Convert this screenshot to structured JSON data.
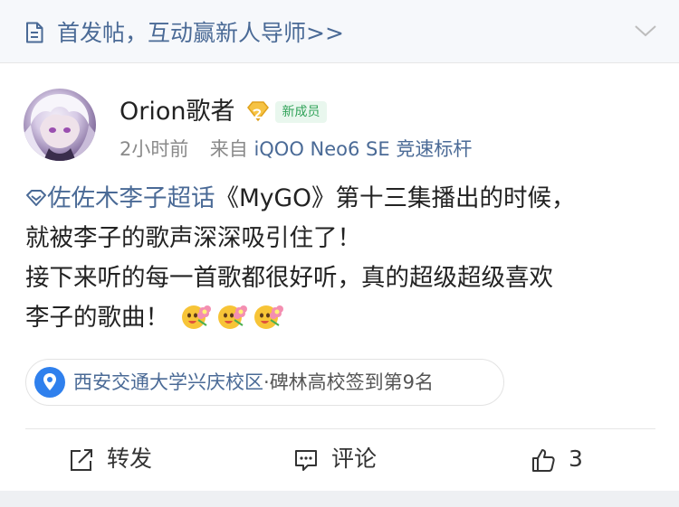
{
  "banner": {
    "text": "首发帖，互动赢新人导师>>",
    "doc_icon": "document-icon",
    "chevron_icon": "chevron-down-icon"
  },
  "author": {
    "name": "Orion歌者",
    "vip_icon": "vip-diamond-badge-icon",
    "member_badge": "新成员",
    "time": "2小时前",
    "from_prefix": "来自",
    "device": "iQOO Neo6 SE 竞速标杆"
  },
  "post": {
    "topic": "佐佐木李子超话",
    "line1_rest": "《MyGO》第十三集播出的时候，",
    "line2": "就被李子的歌声深深吸引住了！",
    "line3": "接下来听的每一首歌都很好听，真的超级超级喜欢",
    "line4": "李子的歌曲！",
    "emojis": [
      "flower-face-emoji",
      "flower-face-emoji",
      "flower-face-emoji"
    ]
  },
  "location": {
    "place": "西安交通大学兴庆校区",
    "separator": "·",
    "rank": "碑林高校签到第9名",
    "icon": "location-pin-icon"
  },
  "actions": {
    "repost_label": "转发",
    "comment_label": "评论",
    "like_count": "3"
  },
  "colors": {
    "link": "#4a6a96",
    "badge_green": "#32a35a",
    "pin_blue": "#2f80ed"
  }
}
